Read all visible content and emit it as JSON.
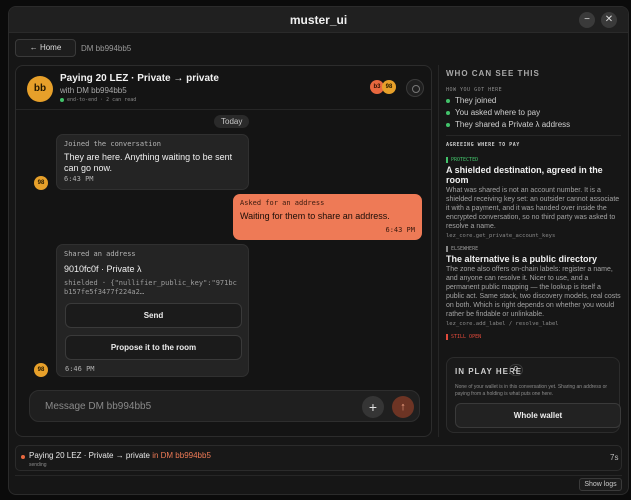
{
  "window": {
    "title": "muster_ui",
    "minimize_glyph": "−",
    "close_glyph": "✕"
  },
  "nav": {
    "home_label": "← Home",
    "breadcrumb": "DM bb994bb5"
  },
  "chat": {
    "avatar_initials": "bb",
    "title": "Paying 20 LEZ · Private → private",
    "subtitle": "with DM bb994bb5",
    "encryption": "end-to-end · 2 can read",
    "participants": [
      "b3",
      "98"
    ],
    "date_chip": "Today",
    "messages": [
      {
        "label": "Joined the conversation",
        "text": "They are here. Anything waiting to be sent can go now.",
        "time": "6:43 PM",
        "sender": "98"
      },
      {
        "label": "Asked for an address",
        "text": "Waiting for them to share an address.",
        "time": "6:43 PM"
      },
      {
        "label": "Shared an address",
        "text": "9010fc0f · Private λ",
        "code_line1": "shielded · {\"nullifier_public_key\":\"971bc",
        "code_line2": "b157fe5f3477f224a2…",
        "send_label": "Send",
        "propose_label": "Propose it to the room",
        "time": "6:46 PM",
        "sender": "98"
      }
    ],
    "composer_placeholder": "Message DM bb994bb5",
    "plus_glyph": "+",
    "send_glyph": "↑"
  },
  "side": {
    "heading": "WHO CAN SEE THIS",
    "how_caption": "HOW YOU GOT HERE",
    "how_items": [
      "They joined",
      "You asked where to pay",
      "They shared a Private λ address"
    ],
    "agree_heading": "AGREEING WHERE TO PAY",
    "protected": {
      "tag": "PROTECTED",
      "title": "A shielded destination, agreed in the room",
      "body": "What was shared is not an account number. It is a shielded receiving key set: an outsider cannot associate it with a payment, and it was handed over inside the encrypted conversation, so no third party was asked to resolve a name.",
      "code": "lez_core.get_private_account_keys"
    },
    "elsewhere": {
      "tag": "ELSEWHERE",
      "title": "The alternative is a public directory",
      "body": "The zone also offers on-chain labels: register a name, and anyone can resolve it. Nicer to use, and a permanent public mapping — the lookup is itself a public act. Same stack, two discovery models, real costs on both. Which is right depends on whether you would rather be findable or unlinkable.",
      "code": "lez_core.add_label / resolve_label"
    },
    "still_open_tag": "STILL OPEN",
    "in_play": {
      "heading": "IN PLAY HERE",
      "count": "0",
      "note": "None of your wallet is in this conversation yet. Sharing an address or paying from a holding is what puts one here.",
      "button": "Whole wallet"
    }
  },
  "status": {
    "title": "Paying 20 LEZ · Private → private",
    "dm": "in DM bb994bb5",
    "sub": "sending",
    "elapsed": "7s"
  },
  "logs": {
    "button": "Show logs"
  },
  "colors": {
    "accent": "#ee7a56",
    "avatar": "#e7a02a",
    "protected": "#42c36a",
    "open": "#e24a3b"
  }
}
